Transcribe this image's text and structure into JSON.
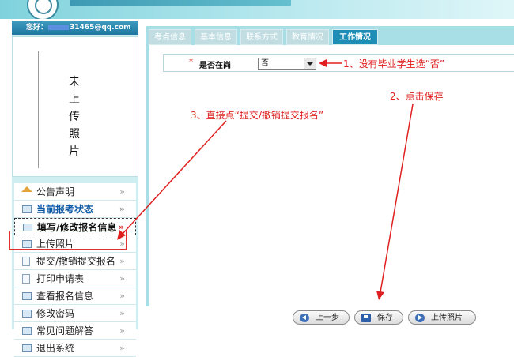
{
  "user": {
    "greeting": "您好：",
    "email_suffix": "31465@qq.com"
  },
  "photo": {
    "placeholder_chars": [
      "未",
      "上",
      "传",
      "照",
      "片"
    ]
  },
  "menu": {
    "items": [
      {
        "label": "公告声明",
        "icon": "house-icon"
      },
      {
        "label": "当前报考状态",
        "icon": "window-icon"
      },
      {
        "label": "填写/修改报名信息",
        "icon": "window-icon",
        "chevron": "»"
      },
      {
        "label": "上传照片",
        "icon": "window-icon"
      },
      {
        "label": "提交/撤销提交报名",
        "icon": "document-icon"
      },
      {
        "label": "打印申请表",
        "icon": "document-icon"
      },
      {
        "label": "查看报名信息",
        "icon": "window-icon"
      },
      {
        "label": "修改密码",
        "icon": "window-icon"
      },
      {
        "label": "常见问题解答",
        "icon": "window-icon"
      },
      {
        "label": "退出系统",
        "icon": "window-icon"
      }
    ],
    "chevron": "»"
  },
  "tabs": [
    {
      "label": "考点信息"
    },
    {
      "label": "基本信息"
    },
    {
      "label": "联系方式"
    },
    {
      "label": "教育情况"
    },
    {
      "label": "工作情况",
      "active": true
    }
  ],
  "form": {
    "required_mark": "*",
    "field_label": "是否在岗",
    "field_value": "否"
  },
  "annotations": {
    "note1": "1、没有毕业学生选“否”",
    "note2": "2、点击保存",
    "note3": "3、直接点“提交/撤销提交报名”"
  },
  "buttons": {
    "prev": "上一步",
    "save": "保存",
    "upload_photo": "上传照片"
  },
  "colors": {
    "accent": "#1f8eb7",
    "annotation": "#e02020",
    "panel_bg": "#cfeef2",
    "main_bg": "#a8dfe6"
  }
}
